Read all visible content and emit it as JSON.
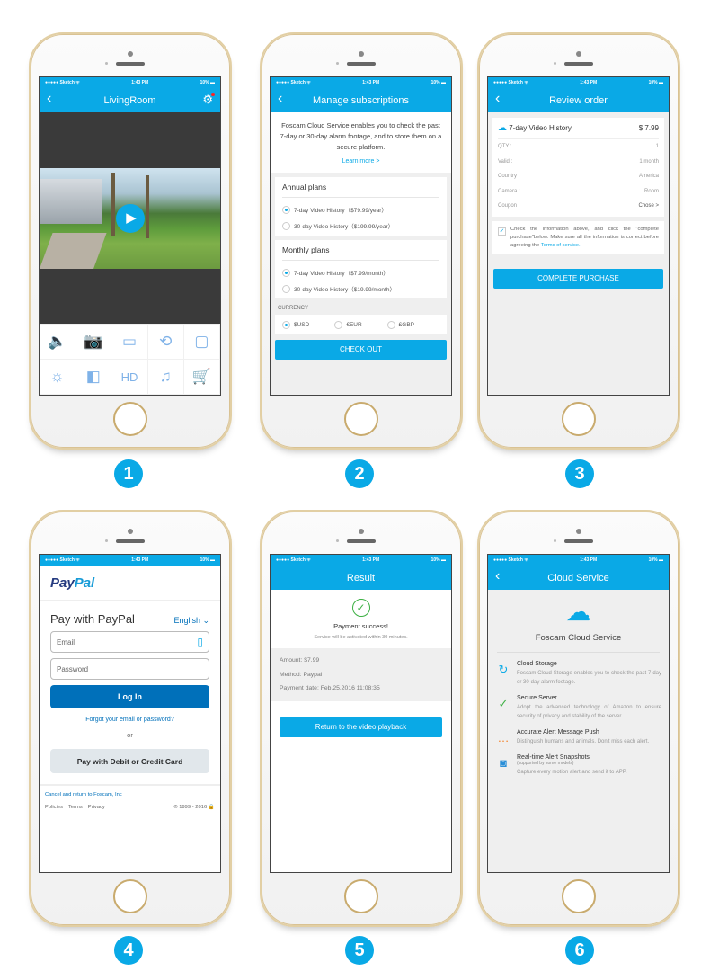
{
  "status_bar": {
    "carrier": "●●●●● Sketch ᯤ",
    "time": "1:43 PM",
    "battery": "10% ▬"
  },
  "badges": [
    "1",
    "2",
    "3",
    "4",
    "5",
    "6"
  ],
  "screen1": {
    "title": "LivingRoom",
    "back_icon": "‹",
    "settings_icon": "⚙",
    "play_icon": "▶",
    "controls": [
      {
        "name": "speaker-icon",
        "glyph": "🔈"
      },
      {
        "name": "camera-snapshot-icon",
        "glyph": "📷"
      },
      {
        "name": "record-video-icon",
        "glyph": "▭"
      },
      {
        "name": "pan-tilt-icon",
        "glyph": "⟲"
      },
      {
        "name": "rotate-icon",
        "glyph": "▢"
      },
      {
        "name": "day-night-icon",
        "glyph": "☼"
      },
      {
        "name": "mirror-flip-icon",
        "glyph": "◧"
      },
      {
        "name": "hd-quality-icon",
        "glyph": "HD"
      },
      {
        "name": "music-icon",
        "glyph": "♫"
      },
      {
        "name": "cloud-cart-icon",
        "glyph": "🛒"
      }
    ]
  },
  "screen2": {
    "title": "Manage subscriptions",
    "intro": "Foscam Cloud Service enables you to check the past 7-day or 30-day alarm footage, and to store them on a secure platform.",
    "learn_more": "Learn more >",
    "annual": {
      "title": "Annual plans",
      "options": [
        {
          "label": "7-day Video History（$79.99/year）",
          "selected": true
        },
        {
          "label": "30-day Video History（$199.99/year）",
          "selected": false
        }
      ]
    },
    "monthly": {
      "title": "Monthly plans",
      "options": [
        {
          "label": "7-day Video History（$7.99/month）",
          "selected": true
        },
        {
          "label": "30-day Video History（$19.99/month）",
          "selected": false
        }
      ]
    },
    "currency_label": "CURRENCY",
    "currencies": [
      {
        "label": "$USD",
        "selected": true
      },
      {
        "label": "€EUR",
        "selected": false
      },
      {
        "label": "£GBP",
        "selected": false
      }
    ],
    "checkout": "CHECK OUT"
  },
  "screen3": {
    "title": "Review order",
    "product": "7-day Video History",
    "price": "$ 7.99",
    "rows": [
      {
        "label": "QTY :",
        "value": "1"
      },
      {
        "label": "Valid :",
        "value": "1 month"
      },
      {
        "label": "Country :",
        "value": "America"
      },
      {
        "label": "Camera :",
        "value": "Room"
      },
      {
        "label": "Coupon :",
        "value": "Chose >"
      }
    ],
    "agree_text": "Check the information above, and click the \"complete purchase\"below. Make sure all the information is correct before agreeing the ",
    "terms_link": "Terms of service.",
    "agree_checked": true,
    "complete": "COMPLETE PURCHASE"
  },
  "screen4": {
    "logo_p1": "Pay",
    "logo_p2": "Pal",
    "title": "Pay with PayPal",
    "language": "English ⌄",
    "email_placeholder": "Email",
    "password_placeholder": "Password",
    "login": "Log In",
    "forgot": "Forgot your email or password?",
    "or": "or",
    "card_button": "Pay with Debit or Credit Card",
    "cancel": "Cancel and return to Foscam, Inc",
    "footer_links": [
      "Policies",
      "Terms",
      "Privacy"
    ],
    "copyright": "© 1999 - 2016 🔒"
  },
  "screen5": {
    "title": "Result",
    "success": "Payment success!",
    "sub": "Service will be activated within 30 minutes.",
    "amount": "Amount:  $7.99",
    "method": "Method:  Paypal",
    "date": "Payment date:  Feb.25.2016  11:08:35",
    "return_button": "Return to the video playback"
  },
  "screen6": {
    "title": "Cloud Service",
    "heading": "Foscam Cloud Service",
    "features": [
      {
        "title": "Cloud Storage",
        "sub": "",
        "desc": "Foscam Cloud Storage enables you to check the past 7-day or 30-day alarm footage.",
        "icon": "↻",
        "color": "#0aa9e6"
      },
      {
        "title": "Secure Server",
        "sub": "",
        "desc": "Adopt the advanced technology of Amazon to ensure security of privacy and stability of the server.",
        "icon": "✓",
        "color": "#3cb043"
      },
      {
        "title": "Accurate Alert Message Push",
        "sub": "",
        "desc": "Distinguish humans and animals. Don't miss each alert.",
        "icon": "…",
        "color": "#f57d20"
      },
      {
        "title": "Real-time Alert Snapshots",
        "sub": "(supported by some models)",
        "desc": "Capture every motion alert and send it to APP.",
        "icon": "◙",
        "color": "#2a8fd8"
      }
    ]
  },
  "colors": {
    "accent": "#0aa9e6",
    "paypal_blue": "#0070ba",
    "success": "#3cb043",
    "cart": "#f57d20"
  }
}
